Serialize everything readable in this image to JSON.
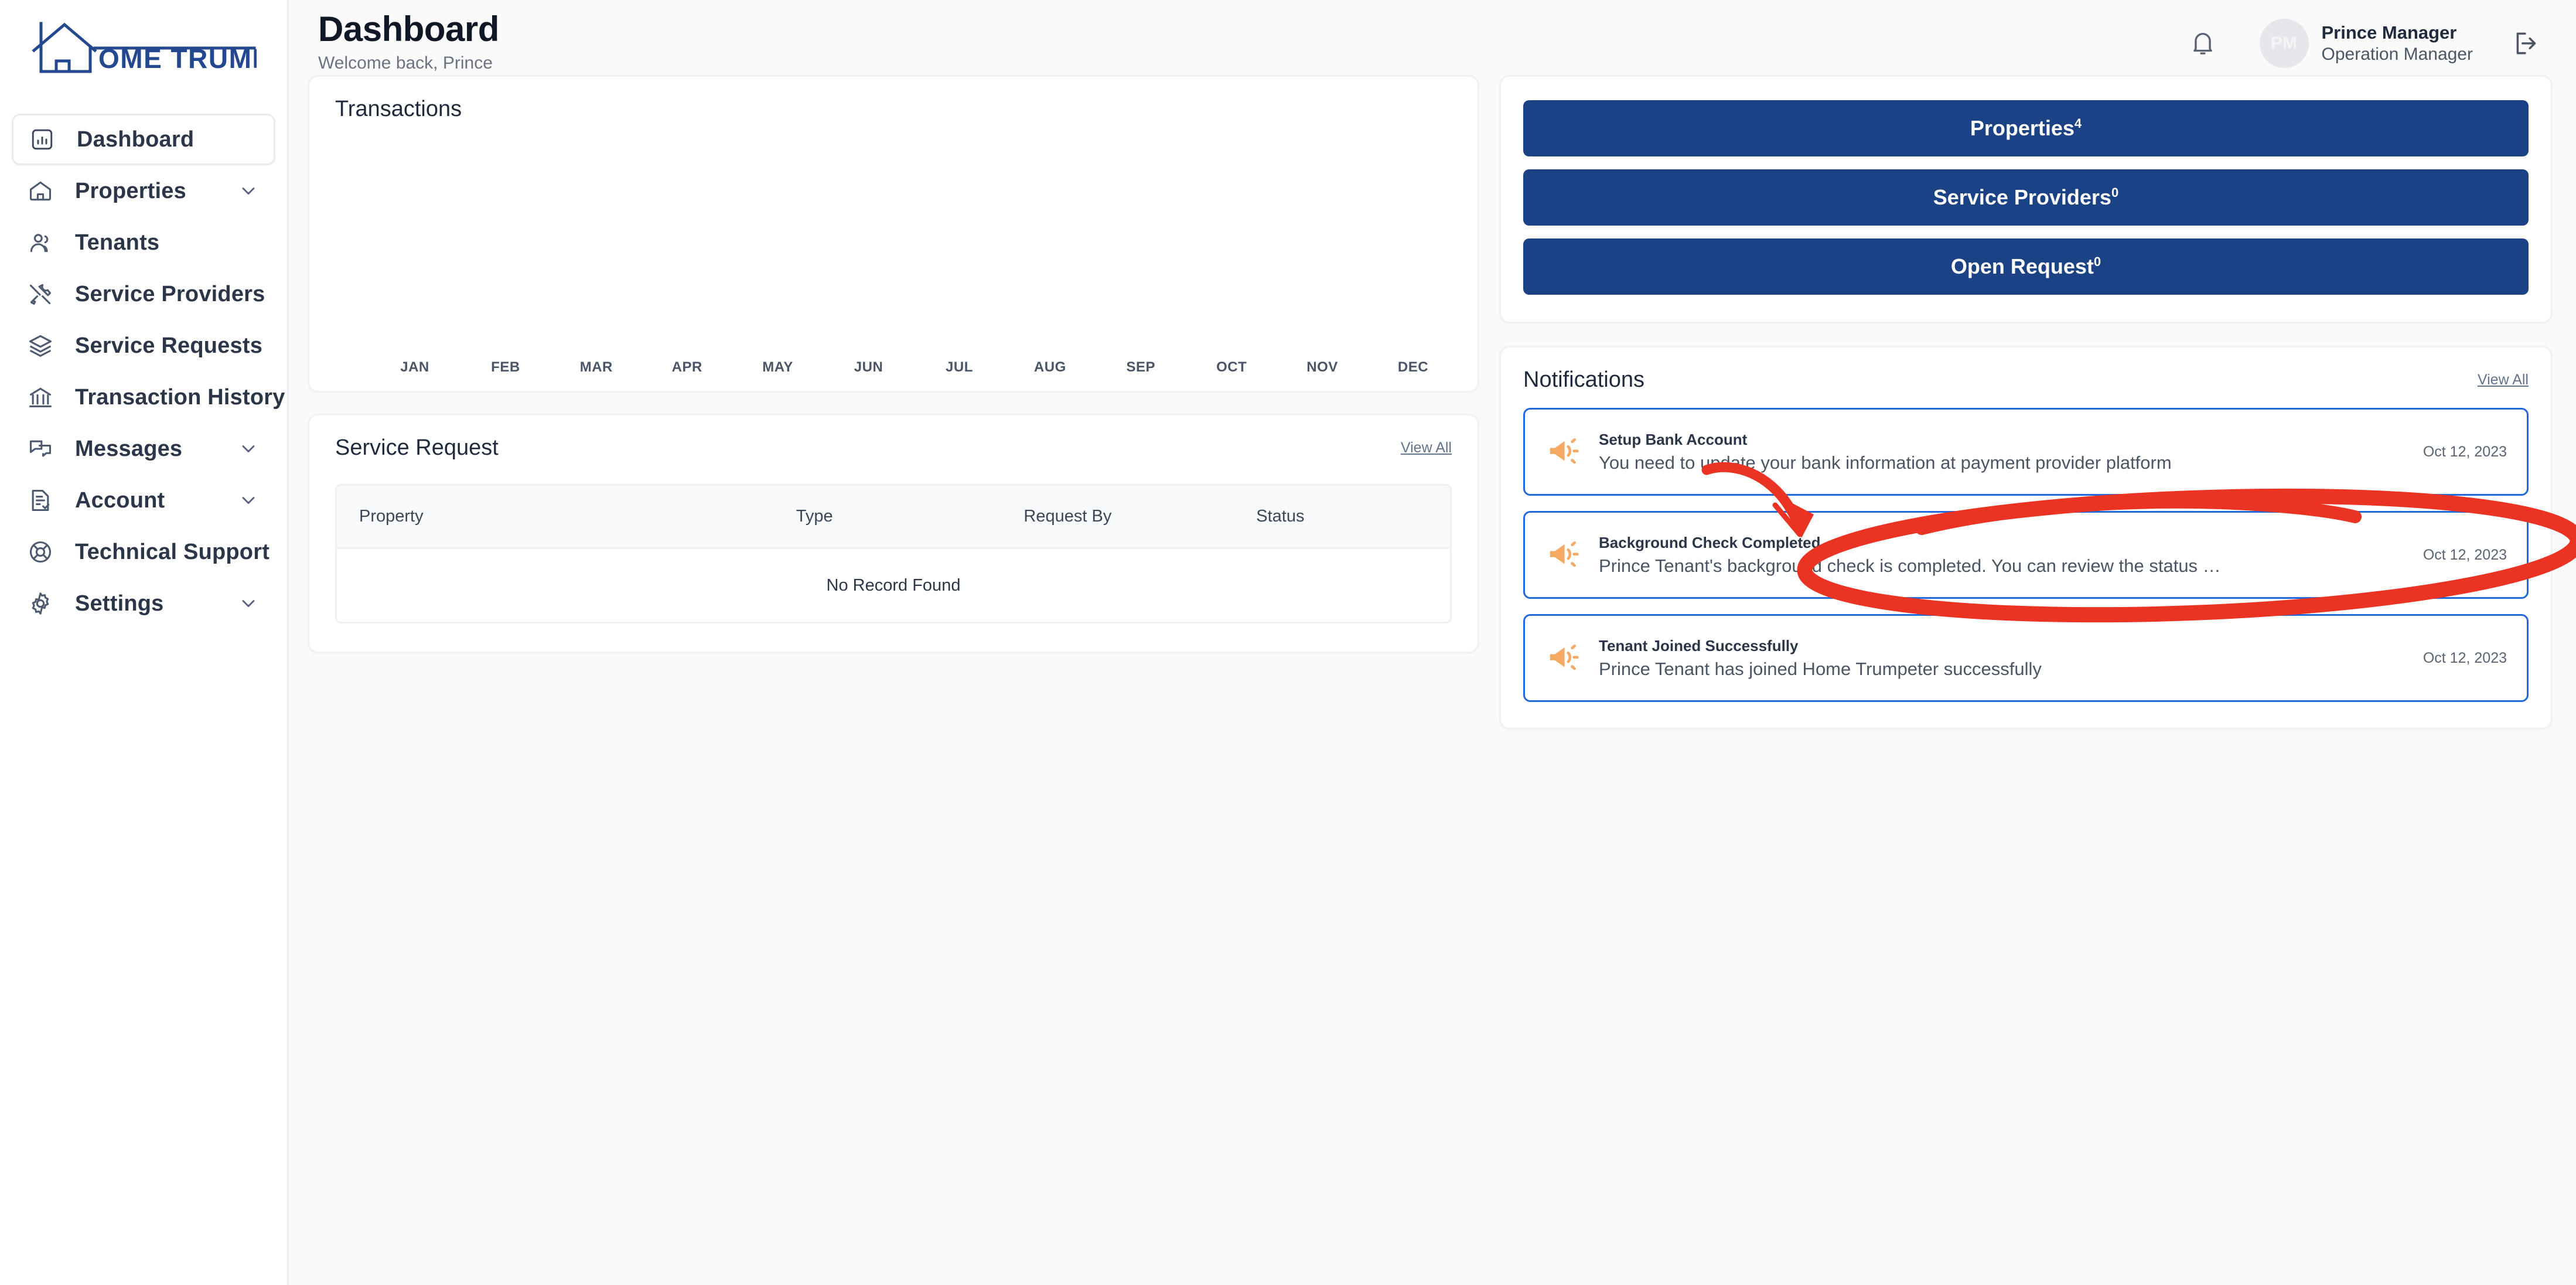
{
  "brand": {
    "name": "OME TRUMPETER",
    "full_name": "HOME TRUMPETER",
    "color": "#24488f"
  },
  "sidebar": {
    "items": [
      {
        "label": "Dashboard",
        "icon": "chart-bar-icon",
        "active": true,
        "expandable": false
      },
      {
        "label": "Properties",
        "icon": "home-icon",
        "active": false,
        "expandable": true
      },
      {
        "label": "Tenants",
        "icon": "users-icon",
        "active": false,
        "expandable": false
      },
      {
        "label": "Service Providers",
        "icon": "tools-icon",
        "active": false,
        "expandable": false
      },
      {
        "label": "Service Requests",
        "icon": "layers-icon",
        "active": false,
        "expandable": false
      },
      {
        "label": "Transaction History",
        "icon": "bank-icon",
        "active": false,
        "expandable": false
      },
      {
        "label": "Messages",
        "icon": "chat-icon",
        "active": false,
        "expandable": true
      },
      {
        "label": "Account",
        "icon": "document-check-icon",
        "active": false,
        "expandable": true
      },
      {
        "label": "Technical Support",
        "icon": "lifebuoy-icon",
        "active": false,
        "expandable": false
      },
      {
        "label": "Settings",
        "icon": "gear-icon",
        "active": false,
        "expandable": true
      }
    ]
  },
  "header": {
    "title": "Dashboard",
    "subtitle": "Welcome back, Prince",
    "notification_icon": "bell-icon",
    "avatar_initials": "PM",
    "user_name": "Prince Manager",
    "user_role": "Operation Manager",
    "logout_icon": "logout-icon"
  },
  "transactions": {
    "title": "Transactions"
  },
  "chart_data": {
    "type": "bar",
    "title": "Transactions",
    "categories": [
      "JAN",
      "FEB",
      "MAR",
      "APR",
      "MAY",
      "JUN",
      "JUL",
      "AUG",
      "SEP",
      "OCT",
      "NOV",
      "DEC"
    ],
    "values": [
      0,
      0,
      0,
      0,
      0,
      0,
      0,
      0,
      0,
      0,
      0,
      0
    ],
    "xlabel": "",
    "ylabel": "",
    "ylim": [
      0,
      0
    ],
    "grid": false,
    "legend": "none",
    "note": "Chart area is empty — no data plotted"
  },
  "service_request": {
    "title": "Service Request",
    "view_all": "View All",
    "columns": [
      "Property",
      "Type",
      "Request By",
      "Status"
    ],
    "rows": [],
    "empty_text": "No Record Found"
  },
  "stats": [
    {
      "label": "Properties",
      "count": "4"
    },
    {
      "label": "Service Providers",
      "count": "0"
    },
    {
      "label": "Open Request",
      "count": "0"
    }
  ],
  "notifications": {
    "title": "Notifications",
    "view_all": "View All",
    "items": [
      {
        "icon": "megaphone-icon",
        "title": "Setup Bank Account",
        "message": "You need to update your bank information at payment provider platform",
        "date": "Oct 12, 2023"
      },
      {
        "icon": "megaphone-icon",
        "title": "Background Check Completed",
        "message": "Prince Tenant's background check is completed. You can review the status …",
        "date": "Oct 12, 2023"
      },
      {
        "icon": "megaphone-icon",
        "title": "Tenant Joined Successfully",
        "message": "Prince Tenant has joined Home Trumpeter successfully",
        "date": "Oct 12, 2023"
      }
    ]
  },
  "annotation": {
    "color": "#ea3323",
    "arrow": "curved-arrow-pointing-to-notification",
    "ellipse": "red-ellipse-highlighting-background-check-notification"
  },
  "colors": {
    "brand_blue": "#24488f",
    "button_blue": "#1b4285",
    "notif_border": "#2068db",
    "megaphone_orange": "#f5a962",
    "annotation_red": "#ea3323",
    "page_bg": "#fafafb"
  }
}
